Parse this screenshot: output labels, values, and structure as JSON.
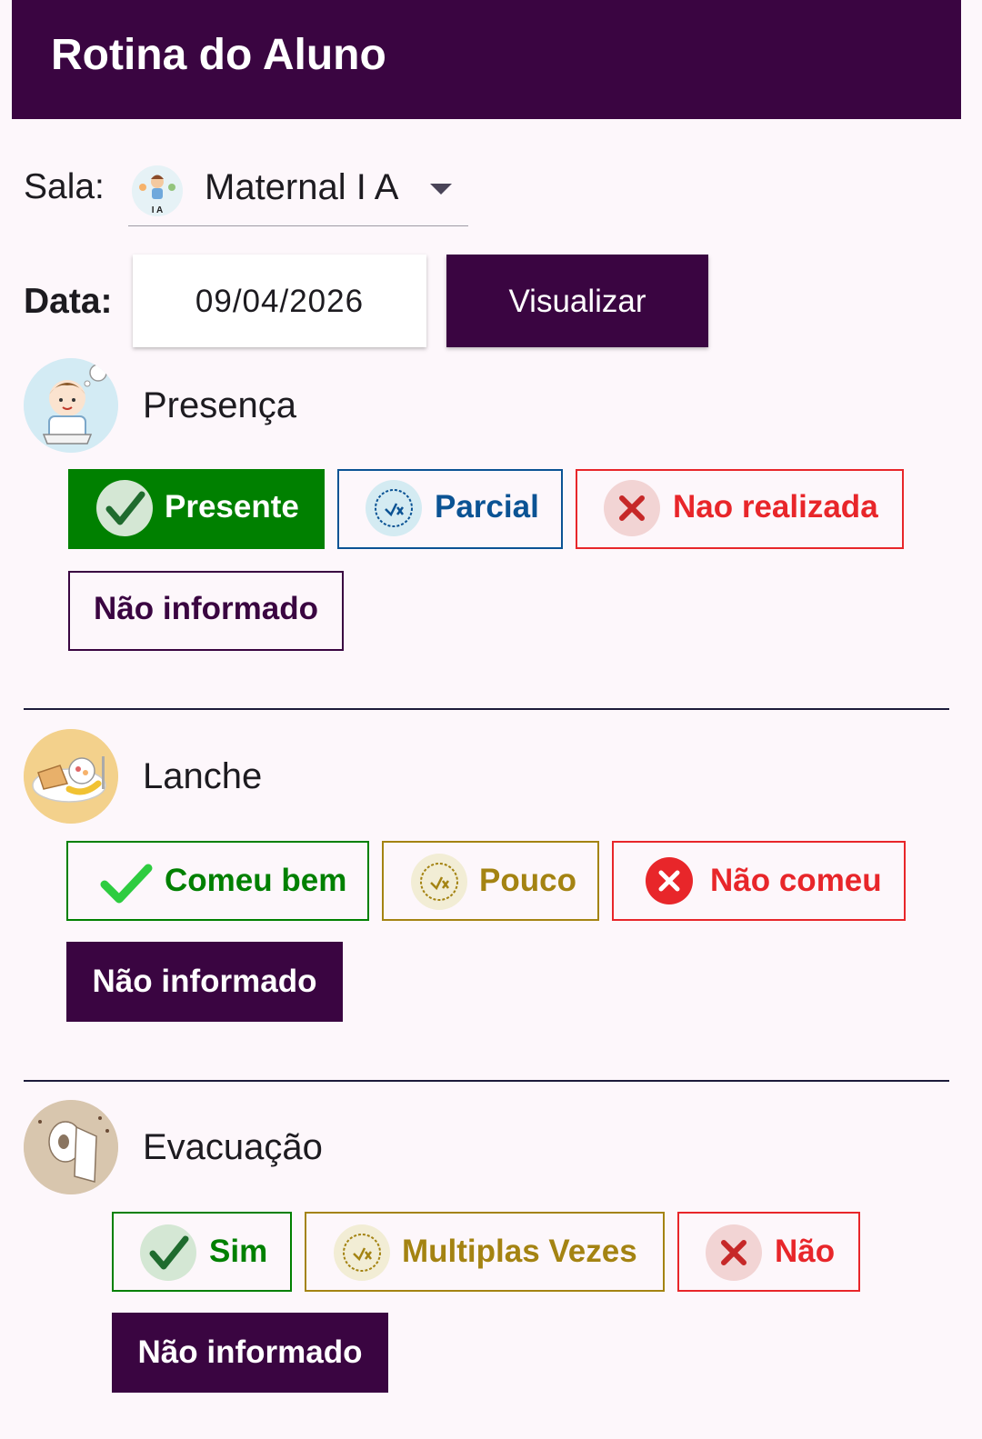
{
  "appbar": {
    "title": "Rotina do Aluno"
  },
  "filters": {
    "sala_label": "Sala:",
    "sala_value": "Maternal I A",
    "sala_avatar_text": "I A",
    "data_label": "Data:",
    "data_value": "09/04/2026",
    "visualizar_label": "Visualizar"
  },
  "presenca": {
    "title": "Presença",
    "options": [
      "Presente",
      "Parcial",
      "Nao realizada",
      "Não informado"
    ],
    "selected": "Presente"
  },
  "lanche": {
    "title": "Lanche",
    "options": [
      "Comeu bem",
      "Pouco",
      "Não comeu",
      "Não informado"
    ],
    "selected": "Não informado"
  },
  "evacuacao": {
    "title": "Evacuação",
    "options": [
      "Sim",
      "Multiplas Vezes",
      "Não",
      "Não informado"
    ],
    "selected": "Não informado"
  },
  "colors": {
    "primary": "#3a0541",
    "success": "#008000",
    "partial_blue": "#0b5394",
    "partial_gold": "#a48312",
    "danger": "#e8262a"
  },
  "icons": {
    "check": "check-icon",
    "partial": "parcial-stamp-icon",
    "cross": "x-icon"
  }
}
